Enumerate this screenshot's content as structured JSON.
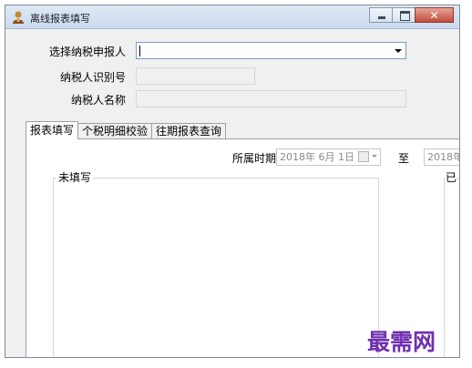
{
  "window": {
    "title": "离线报表填写",
    "buttons": {
      "minimize": "minimize",
      "maximize": "maximize",
      "close": "✕"
    }
  },
  "form": {
    "select_taxpayer_label": "选择纳税申报人",
    "select_taxpayer_value": "",
    "taxpayer_id_label": "纳税人识别号",
    "taxpayer_id_value": "",
    "taxpayer_name_label": "纳税人名称",
    "taxpayer_name_value": ""
  },
  "tabs": [
    {
      "label": "报表填写",
      "active": true
    },
    {
      "label": "个税明细校验",
      "active": false
    },
    {
      "label": "往期报表查询",
      "active": false
    }
  ],
  "period": {
    "label": "所属时期",
    "start_date": "2018年  6月  1日",
    "to_label": "至",
    "end_date": "2018年"
  },
  "groups": {
    "unfilled_title": "未填写",
    "filled_title_partial": "已"
  },
  "watermark": "最需网",
  "colors": {
    "accent_border": "#7a9ec6",
    "close_button": "#c34a3b",
    "watermark": "#6f2fb0"
  },
  "icons": {
    "app": "taxpayer-app-icon",
    "calendar": "calendar-dropdown-icon",
    "combo_arrow": "dropdown-arrow-icon"
  }
}
